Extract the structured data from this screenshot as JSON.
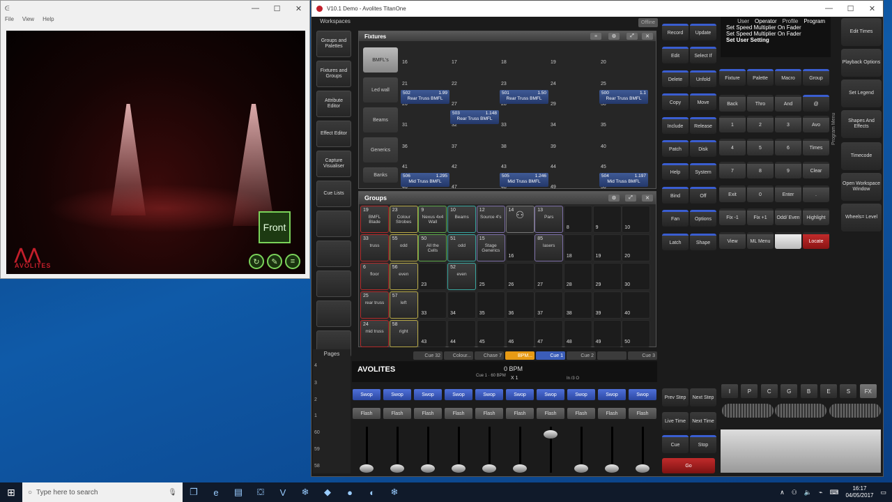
{
  "visualiser": {
    "menu": [
      "File",
      "View",
      "Help"
    ],
    "front_label": "Front",
    "logo_text": "AVOLITES"
  },
  "titan": {
    "title": "V10.1 Demo - Avolites TitanOne",
    "workspaces_label": "Workspaces",
    "offline_label": "Offline",
    "workspaces": [
      "Groups and Palettes",
      "Fixtures and Groups",
      "Attribute Editor",
      "Effect Editor",
      "Capture Visualiser",
      "Cue Lists"
    ]
  },
  "fixtures": {
    "title": "Fixtures",
    "categories": [
      "BMFL's",
      "Led wall",
      "Beams",
      "Generics",
      "Banks"
    ],
    "numbers": [
      [
        "16",
        "17",
        "18",
        "19",
        "20"
      ],
      [
        "21",
        "22",
        "23",
        "24",
        "25"
      ],
      [
        "26",
        "27",
        "28",
        "29",
        "30"
      ],
      [
        "31",
        "32",
        "33",
        "34",
        "35"
      ],
      [
        "36",
        "37",
        "38",
        "39",
        "40"
      ],
      [
        "41",
        "42",
        "43",
        "44",
        "45"
      ],
      [
        "46",
        "47",
        "48",
        "49",
        "50"
      ]
    ],
    "blocks": [
      {
        "id": "502",
        "val": "1.99",
        "name": "Rear Truss BMFL",
        "col": 0,
        "row": 1
      },
      {
        "id": "501",
        "val": "1.50",
        "name": "Rear Truss BMFL",
        "col": 2,
        "row": 1
      },
      {
        "id": "500",
        "val": "1.1",
        "name": "Rear Truss BMFL",
        "col": 4,
        "row": 1
      },
      {
        "id": "503",
        "val": "1.148",
        "name": "Rear Truss BMFL",
        "col": 1,
        "row": 2
      },
      {
        "id": "506",
        "val": "1.295",
        "name": "Mid Truss BMFL",
        "col": 0,
        "row": 5
      },
      {
        "id": "505",
        "val": "1.246",
        "name": "Mid Truss BMFL",
        "col": 2,
        "row": 5
      },
      {
        "id": "504",
        "val": "1.197",
        "name": "Mid Truss BMFL",
        "col": 4,
        "row": 5
      },
      {
        "id": "507",
        "val": "1.344",
        "name": "Mid Truss BMFL",
        "col": 1,
        "row": 6
      }
    ]
  },
  "groups": {
    "title": "Groups",
    "cells": [
      [
        {
          "n": "19",
          "l": "BMFL Blade",
          "c": "#b32a2a"
        },
        {
          "n": "23",
          "l": "Colour Strobes",
          "c": "#b7a948"
        },
        {
          "n": "9",
          "l": "Nexus 4x4 Wall",
          "c": "#5da84a"
        },
        {
          "n": "10",
          "l": "Beams",
          "c": "#3aa7a0"
        },
        {
          "n": "12",
          "l": "Source 4's",
          "c": "#7d6fa8"
        },
        {
          "n": "14",
          "l": "",
          "c": "#777"
        },
        {
          "n": "13",
          "l": "Pars",
          "c": "#7d6fa8"
        },
        {
          "n": "8",
          "l": ""
        },
        {
          "n": "9",
          "l": ""
        },
        {
          "n": "10",
          "l": ""
        }
      ],
      [
        {
          "n": "33",
          "l": "truss",
          "c": "#b32a2a"
        },
        {
          "n": "55",
          "l": "odd",
          "c": "#b7a948"
        },
        {
          "n": "50",
          "l": "All the Cells",
          "c": "#5da84a"
        },
        {
          "n": "51",
          "l": "odd",
          "c": "#3aa7a0"
        },
        {
          "n": "15",
          "l": "Stage Generics",
          "c": "#7d6fa8"
        },
        {
          "n": "16",
          "l": ""
        },
        {
          "n": "85",
          "l": "lasers",
          "c": "#7d6fa8"
        },
        {
          "n": "18",
          "l": ""
        },
        {
          "n": "19",
          "l": ""
        },
        {
          "n": "20",
          "l": ""
        }
      ],
      [
        {
          "n": "6",
          "l": "floor",
          "c": "#b32a2a"
        },
        {
          "n": "56",
          "l": "even",
          "c": "#b7a948"
        },
        {
          "n": "23",
          "l": ""
        },
        {
          "n": "52",
          "l": "even",
          "c": "#3aa7a0"
        },
        {
          "n": "25",
          "l": ""
        },
        {
          "n": "26",
          "l": ""
        },
        {
          "n": "27",
          "l": ""
        },
        {
          "n": "28",
          "l": ""
        },
        {
          "n": "29",
          "l": ""
        },
        {
          "n": "30",
          "l": ""
        }
      ],
      [
        {
          "n": "25",
          "l": "rear truss",
          "c": "#b32a2a"
        },
        {
          "n": "57",
          "l": "left",
          "c": "#b7a948"
        },
        {
          "n": "33",
          "l": ""
        },
        {
          "n": "34",
          "l": ""
        },
        {
          "n": "35",
          "l": ""
        },
        {
          "n": "36",
          "l": ""
        },
        {
          "n": "37",
          "l": ""
        },
        {
          "n": "38",
          "l": ""
        },
        {
          "n": "39",
          "l": ""
        },
        {
          "n": "40",
          "l": ""
        }
      ],
      [
        {
          "n": "24",
          "l": "mid truss",
          "c": "#b32a2a"
        },
        {
          "n": "58",
          "l": "right",
          "c": "#b7a948"
        },
        {
          "n": "43",
          "l": ""
        },
        {
          "n": "44",
          "l": ""
        },
        {
          "n": "45",
          "l": ""
        },
        {
          "n": "46",
          "l": ""
        },
        {
          "n": "47",
          "l": ""
        },
        {
          "n": "48",
          "l": ""
        },
        {
          "n": "49",
          "l": ""
        },
        {
          "n": "50",
          "l": ""
        }
      ]
    ]
  },
  "right_buttons": [
    [
      "Record",
      "Update"
    ],
    [
      "Edit",
      "Select If"
    ],
    [
      "Delete",
      "Unfold"
    ],
    [
      "Copy",
      "Move"
    ],
    [
      "Include",
      "Release"
    ],
    [
      "Patch",
      "Disk"
    ],
    [
      "Help",
      "System"
    ],
    [
      "Bind",
      "Off"
    ],
    [
      "Fan",
      "Options"
    ],
    [
      "Latch",
      "Shape"
    ]
  ],
  "info": {
    "modes": [
      "User",
      "Operator",
      "Profile",
      "Program"
    ],
    "lines": [
      "Set Speed Multiplier On Fader",
      "Set Speed Multiplier On Fader",
      "Set User Setting"
    ]
  },
  "keypad": [
    [
      "Fixture",
      "Palette",
      "Macro",
      "Group"
    ],
    [
      "Back",
      "Thro",
      "And",
      "@"
    ],
    [
      "1",
      "2",
      "3",
      "Avo"
    ],
    [
      "4",
      "5",
      "6",
      "Times"
    ],
    [
      "7",
      "8",
      "9",
      "Clear"
    ],
    [
      "Exit",
      "0",
      "Enter",
      "."
    ],
    [
      "Fix -1",
      "Fix +1",
      "Odd/ Even",
      "Highlight"
    ],
    [
      "View",
      "ML Menu",
      "",
      "Locate"
    ]
  ],
  "program_menu": "Program Menu",
  "side_menu": [
    "Edit Times",
    "Playback Options",
    "Set Legend",
    "Shapes And Effects",
    "Timecode",
    "Open Workspace Window",
    "Wheels= Level"
  ],
  "playback": {
    "pages_label": "Pages",
    "page_numbers": [
      "4",
      "3",
      "2",
      "1",
      "60",
      "59",
      "58"
    ],
    "tabs": [
      "Cue 32",
      "Colour...",
      "Chase 7",
      "BPM...",
      "Cue 1",
      "Cue 2",
      "",
      "Cue 3"
    ],
    "bpm": "0 BPM",
    "cue_info": "Cue 1 · 60 BPM",
    "multiplier": "X 1",
    "in_text": "In /3 O",
    "swop": "Swop",
    "flash": "Flash",
    "faders": [
      0,
      0,
      0,
      0,
      0,
      0,
      0.9,
      0,
      0,
      0
    ],
    "exec_buttons": [
      [
        "Prev Step",
        "Next Step"
      ],
      [
        "Live Time",
        "Next Time"
      ],
      [
        "Cue",
        "Stop"
      ],
      [
        "Go"
      ]
    ],
    "function_keys": [
      "I",
      "P",
      "C",
      "G",
      "B",
      "E",
      "S",
      "FX"
    ]
  },
  "taskbar": {
    "search_placeholder": "Type here to search",
    "time": "16:17",
    "date": "04/05/2017"
  }
}
